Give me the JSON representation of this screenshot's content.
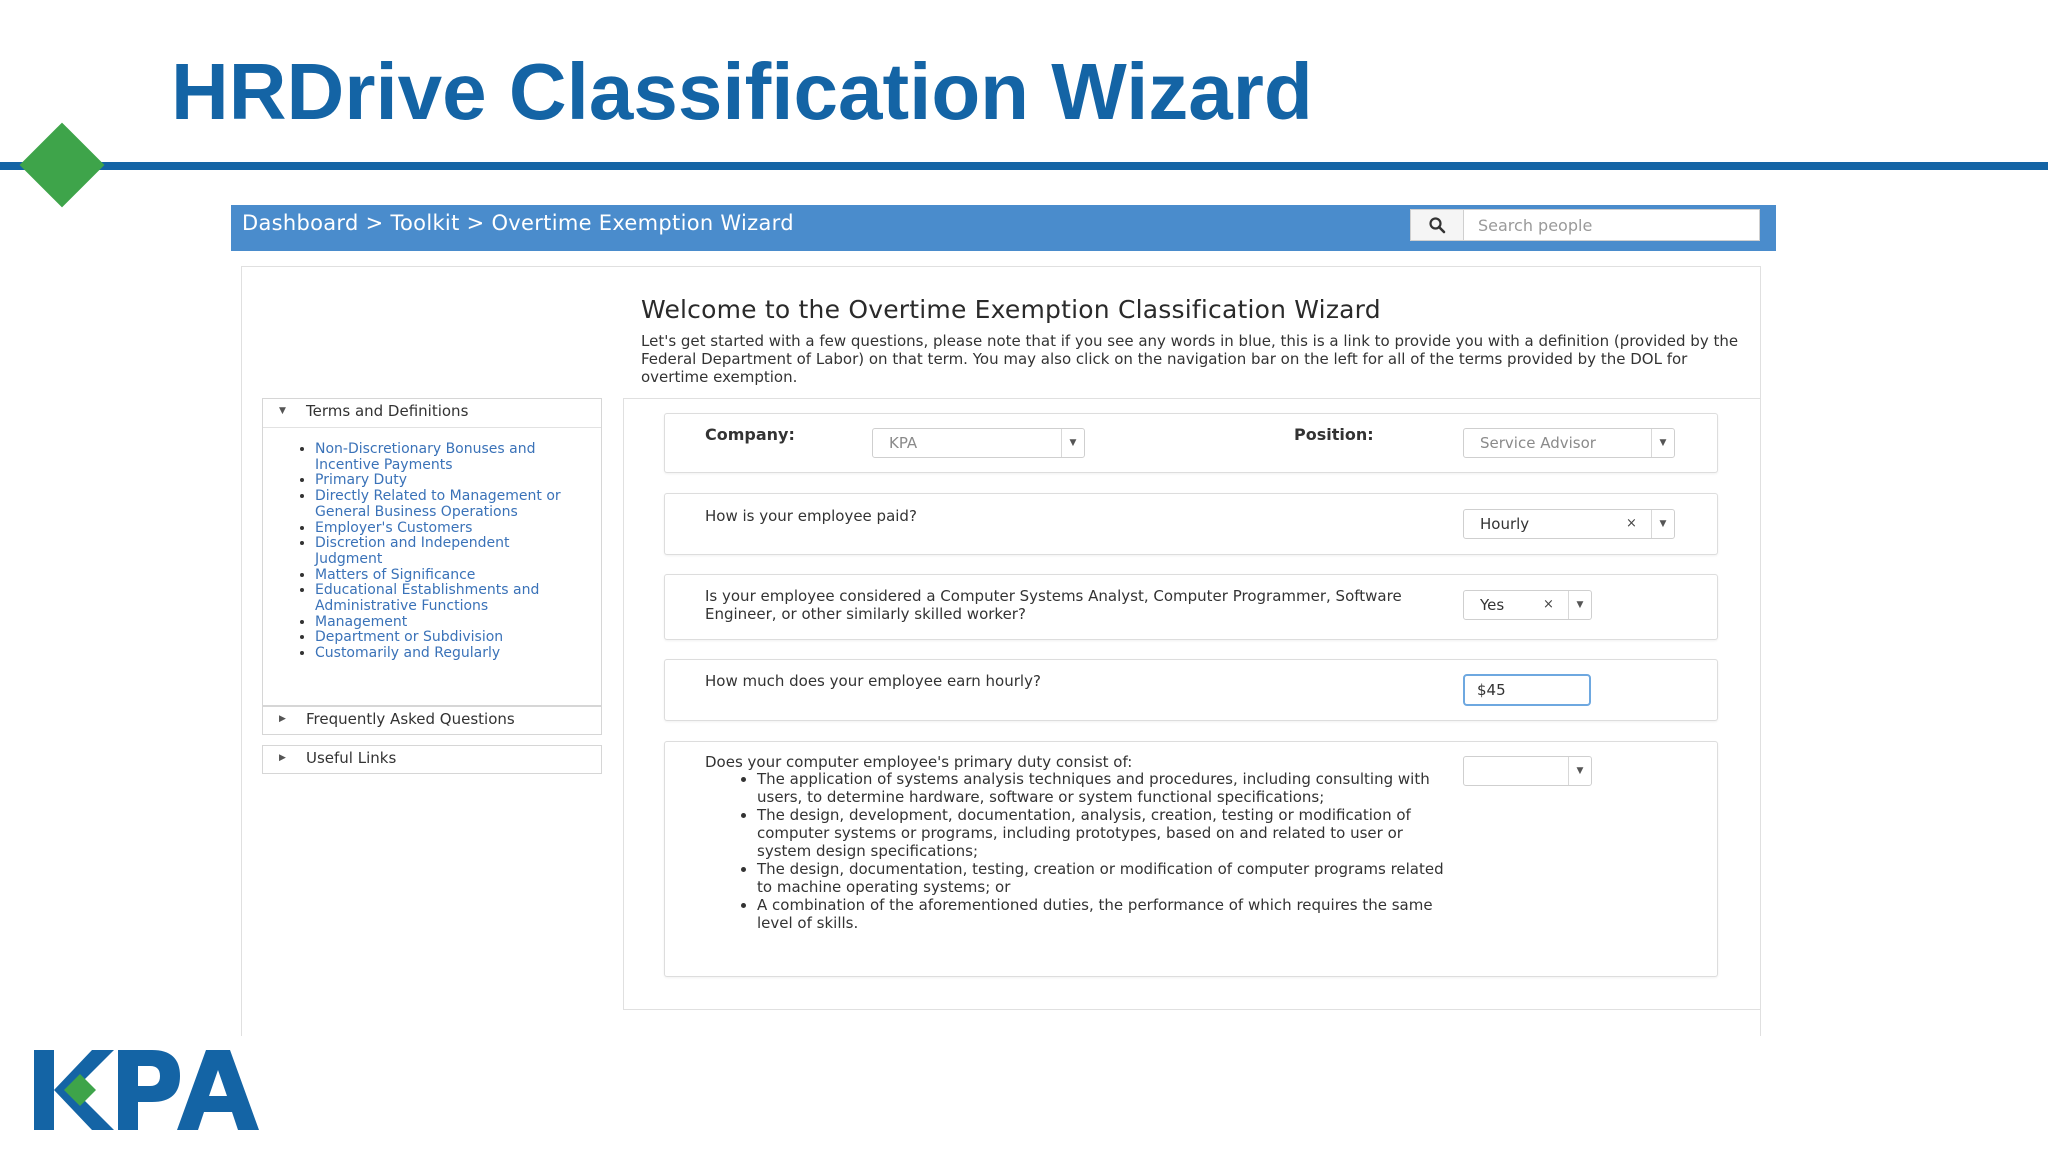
{
  "slide": {
    "title": "HRDrive Classification Wizard",
    "logo_text": "KPA",
    "colors": {
      "title_blue": "#1464a5",
      "accent_green": "#3ea44a",
      "navbar": "#4a8ccc"
    }
  },
  "navbar": {
    "breadcrumb": "Dashboard > Toolkit > Overtime Exemption Wizard",
    "search_placeholder": "Search people",
    "search_icon": "search-icon"
  },
  "welcome": {
    "title": "Welcome to the Overtime Exemption Classification Wizard",
    "intro": "Let's get started with a few questions, please note that if you see any words in blue, this is a link to provide you with a definition (provided by the Federal Department of Labor) on that term. You may also click on the navigation bar on the left for all of the terms provided by the DOL for overtime exemption."
  },
  "sidebar": {
    "terms_header": "Terms and Definitions",
    "terms": [
      "Non-Discretionary Bonuses and Incentive Payments",
      "Primary Duty",
      "Directly Related to Management or General Business Operations",
      "Employer's Customers",
      "Discretion and Independent Judgment",
      "Matters of Significance",
      "Educational Establishments and Administrative Functions",
      "Management",
      "Department or Subdivision",
      "Customarily and Regularly"
    ],
    "faq_header": "Frequently Asked Questions",
    "links_header": "Useful Links"
  },
  "form": {
    "company_label": "Company:",
    "company_value": "KPA",
    "position_label": "Position:",
    "position_value": "Service Advisor",
    "q_paid": "How is your employee paid?",
    "q_paid_value": "Hourly",
    "q_computer": "Is your employee considered a Computer Systems Analyst, Computer Programmer, Software Engineer, or other similarly skilled worker?",
    "q_computer_value": "Yes",
    "q_earn": "How much does your employee earn hourly?",
    "q_earn_value": "$45",
    "q_duty": "Does your computer employee's primary duty consist of:",
    "q_duty_items": [
      "The application of systems analysis techniques and procedures, including consulting with users, to determine hardware, software or system functional specifications;",
      "The design, development, documentation, analysis, creation, testing or modification of computer systems or programs, including prototypes, based on and related to user or system design specifications;",
      "The design, documentation, testing, creation or modification of computer programs related to machine operating systems; or",
      "A combination of the aforementioned duties, the performance of which requires the same level of skills."
    ],
    "q_duty_value": "",
    "clear_glyph": "×",
    "dropdown_glyph": "▼"
  }
}
